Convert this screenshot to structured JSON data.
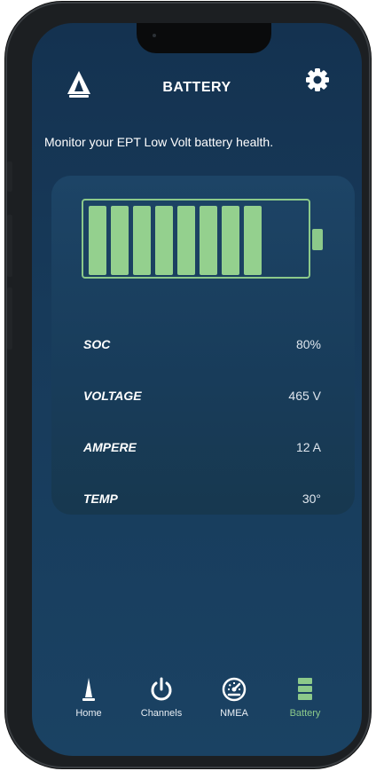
{
  "header": {
    "title": "BATTERY",
    "logo_icon": "sailboat-logo-icon",
    "settings_icon": "gear-icon"
  },
  "subtitle": "Monitor  your  EPT Low Volt battery health.",
  "battery": {
    "charge_percent": 80,
    "filled_cells": 8,
    "total_cells": 10,
    "color": "#94d08e"
  },
  "stats": [
    {
      "label": "SOC",
      "value": "80%"
    },
    {
      "label": "VOLTAGE",
      "value": "465 V"
    },
    {
      "label": "AMPERE",
      "value": "12 A"
    },
    {
      "label": "TEMP",
      "value": "30°"
    }
  ],
  "nav": {
    "items": [
      {
        "label": "Home",
        "icon": "sailboat-icon",
        "active": false
      },
      {
        "label": "Channels",
        "icon": "power-icon",
        "active": false
      },
      {
        "label": "NMEA",
        "icon": "gauge-icon",
        "active": false
      },
      {
        "label": "Battery",
        "icon": "battery-icon",
        "active": true
      }
    ],
    "active_color": "#8cc98a"
  }
}
